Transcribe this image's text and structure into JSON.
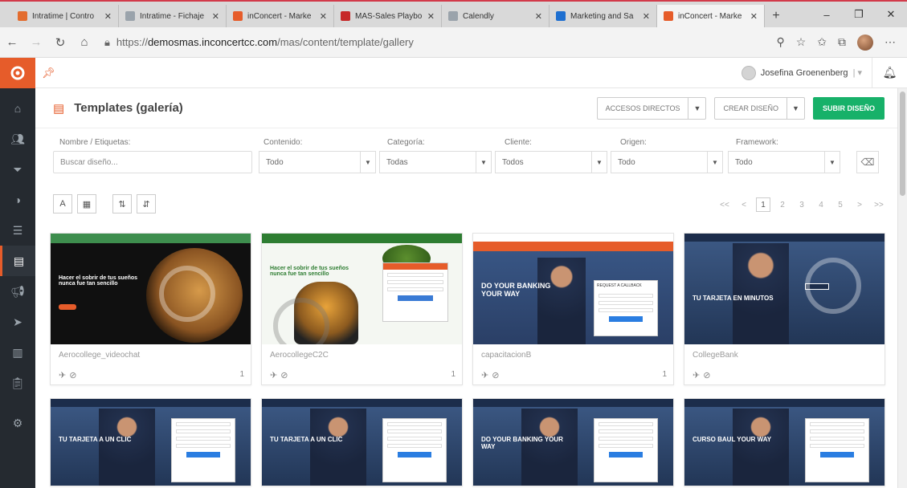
{
  "browser": {
    "tabs": [
      {
        "title": "Intratime | Contro",
        "color": "#e36c2e",
        "active": false
      },
      {
        "title": "Intratime - Fichaje",
        "color": "#9aa3ab",
        "active": false
      },
      {
        "title": "inConcert - Marke",
        "color": "#e65c2a",
        "active": false
      },
      {
        "title": "MAS-Sales Playbo",
        "color": "#c62828",
        "active": false
      },
      {
        "title": "Calendly",
        "color": "#9aa3ab",
        "active": false
      },
      {
        "title": "Marketing and Sa",
        "color": "#1e6fd0",
        "active": false
      },
      {
        "title": "inConcert - Marke",
        "color": "#e65c2a",
        "active": true
      }
    ],
    "url_scheme": "https://",
    "url_host": "demosmas.inconcertcc.com",
    "url_path": "/mas/content/template/gallery"
  },
  "user": {
    "name": "Josefina Groenenberg"
  },
  "page": {
    "title": "Templates (galería)",
    "btn_shortcuts": "ACCESOS DIRECTOS",
    "btn_create": "CREAR DISEÑO",
    "btn_upload": "SUBIR DISEÑO"
  },
  "filters": {
    "name_label": "Nombre / Etiquetas:",
    "name_placeholder": "Buscar diseño...",
    "content_label": "Contenido:",
    "content_value": "Todo",
    "category_label": "Categoría:",
    "category_value": "Todas",
    "client_label": "Cliente:",
    "client_value": "Todos",
    "origin_label": "Origen:",
    "origin_value": "Todo",
    "framework_label": "Framework:",
    "framework_value": "Todo"
  },
  "pagination": {
    "first": "<<",
    "prev": "<",
    "pages": [
      "1",
      "2",
      "3",
      "4",
      "5"
    ],
    "next": ">",
    "last": ">>"
  },
  "cards": [
    {
      "name": "Aerocollege_videochat",
      "count": "1",
      "headline": "Hacer el sobrir de tus sueños nunca fue tan sencillo",
      "theme": "lion"
    },
    {
      "name": "AerocollegeC2C",
      "count": "1",
      "headline": "Hacer el sobrir de tus sueños nunca fue tan sencillo",
      "theme": "tiger"
    },
    {
      "name": "capacitacionB",
      "count": "1",
      "headline": "DO YOUR BANKING YOUR WAY",
      "form_title": "REQUEST A CALLBACK",
      "theme": "bank-orange"
    },
    {
      "name": "CollegeBank",
      "count": "",
      "headline": "TU TARJETA EN MINUTOS",
      "theme": "bank-navy"
    },
    {
      "name": "",
      "count": "",
      "headline": "TU TARJETA A UN CLIC",
      "theme": "bank-navy-form"
    },
    {
      "name": "",
      "count": "",
      "headline": "TU TARJETA A UN CLIC",
      "theme": "bank-navy-form"
    },
    {
      "name": "",
      "count": "",
      "headline": "DO YOUR BANKING YOUR WAY",
      "theme": "bank-navy-form"
    },
    {
      "name": "",
      "count": "",
      "headline": "CURSO BAUL YOUR WAY",
      "theme": "bank-navy-form"
    }
  ],
  "colors": {
    "accent": "#e65c2a",
    "primary_button": "#17b169",
    "sidebar": "#252a30"
  }
}
